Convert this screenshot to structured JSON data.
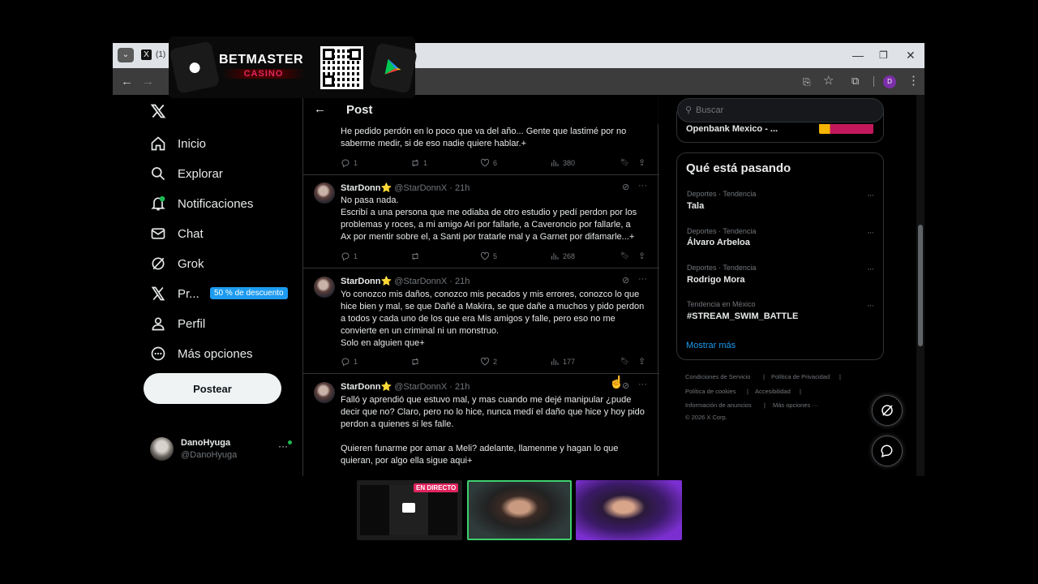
{
  "browser": {
    "tab_label": "(1) ",
    "profile_initial": "D"
  },
  "ad": {
    "brand": "BETMASTER",
    "sub": "CASINO"
  },
  "nav": {
    "items": [
      {
        "label": "Inicio",
        "icon": "home-icon"
      },
      {
        "label": "Explorar",
        "icon": "search-icon"
      },
      {
        "label": "Notificaciones",
        "icon": "bell-icon"
      },
      {
        "label": "Chat",
        "icon": "mail-icon"
      },
      {
        "label": "Grok",
        "icon": "grok-icon"
      },
      {
        "label": "Pr...",
        "icon": "x-logo-icon"
      },
      {
        "label": "Perfil",
        "icon": "person-icon"
      },
      {
        "label": "Más opciones",
        "icon": "more-circle-icon"
      }
    ],
    "premium_badge": "50 % de descuento",
    "post_button": "Postear",
    "account": {
      "name": "DanoHyuga",
      "handle": "@DanoHyuga"
    }
  },
  "header": {
    "title": "Post"
  },
  "tweets": [
    {
      "text_lines": [
        "He pedido perdón en lo poco que va del año... Gente que lastimé por no",
        "saberme medir, si de eso nadie quiere hablar.+"
      ],
      "replies": "1",
      "reposts": "1",
      "likes": "6",
      "views": "380"
    },
    {
      "name": "StarDonn⭐",
      "handle": "@StarDonnX · 21h",
      "text_lines": [
        "No pasa nada.",
        "Escribí a una persona que me odiaba de otro estudio y pedí perdon por los",
        "problemas y roces, a mi amigo Ari por fallarle, a Caveroncio por fallarle, a",
        "Ax por mentir sobre el, a Santi por tratarle mal y a Garnet por difamarle...+"
      ],
      "replies": "1",
      "reposts": "",
      "likes": "5",
      "views": "268"
    },
    {
      "name": "StarDonn⭐",
      "handle": "@StarDonnX · 21h",
      "text_lines": [
        "Yo conozco mis daños, conozco mis pecados y mis errores, conozco lo que",
        "hice bien y mal, se que Dañé a Makira, se que dañe a muchos y pido perdon",
        "a todos y cada uno de los que era Mis amigos y falle, pero eso no me",
        "convierte en un criminal ni un monstruo.",
        "Solo en alguien que+"
      ],
      "replies": "1",
      "reposts": "",
      "likes": "2",
      "views": "177"
    },
    {
      "name": "StarDonn⭐",
      "handle": "@StarDonnX · 21h",
      "text_lines": [
        "Falló y aprendió que estuvo mal, y mas cuando me dejé manipular ¿pude",
        "decir que no? Claro, pero no lo hice, nunca medí el daño que hice y hoy pido",
        "perdon a quienes si les falle.",
        "",
        "Quieren funarme por amar a Meli? adelante, llamenme y hagan lo que",
        "quieran, por algo ella sigue aqui+"
      ]
    }
  ],
  "right": {
    "search_placeholder": "Buscar",
    "promo_text": "Openbank Mexico - ...",
    "trends_title": "Qué está pasando",
    "trends": [
      {
        "category": "Deportes · Tendencia",
        "name": "Tala"
      },
      {
        "category": "Deportes · Tendencia",
        "name": "Álvaro Arbeloa"
      },
      {
        "category": "Deportes · Tendencia",
        "name": "Rodrigo Mora"
      },
      {
        "category": "Tendencia en México",
        "name": "#STREAM_SWIM_BATTLE"
      }
    ],
    "show_more": "Mostrar más",
    "footer": {
      "terms": "Condiciones de Servicio",
      "privacy": "Política de Privacidad",
      "cookies": "Política de cookies",
      "accessibility": "Accesibilidad",
      "ads": "Información de anuncios",
      "more": "Más opciones ···",
      "copyright": "© 2026 X Corp."
    }
  },
  "stream": {
    "live_label": "EN DIRECTO"
  },
  "colors": {
    "accent": "#1d9bf0",
    "live": "#e0245e",
    "green_border": "#3ecf6e"
  }
}
